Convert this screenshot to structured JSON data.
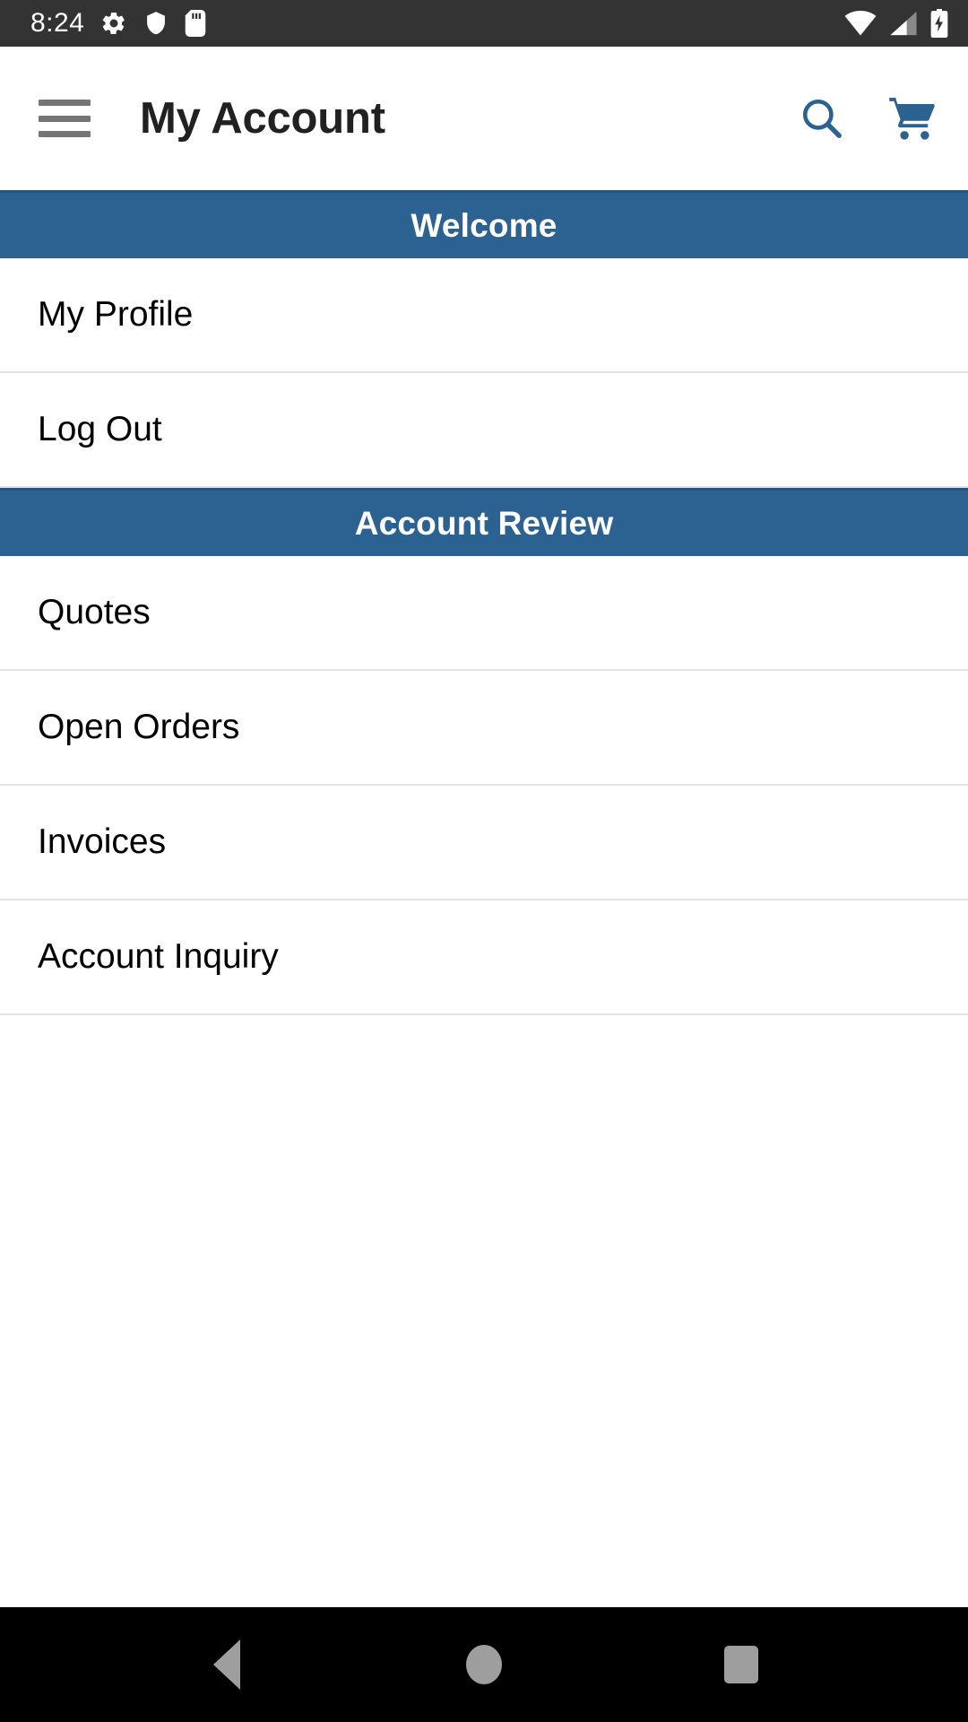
{
  "status_bar": {
    "clock": "8:24",
    "left_icons": [
      {
        "name": "settings-gear-icon",
        "label": "Settings"
      },
      {
        "name": "shield-icon",
        "label": "Security"
      },
      {
        "name": "sd-card-icon",
        "label": "SD Card"
      }
    ],
    "right_icons": [
      {
        "name": "wifi-icon",
        "label": "Wi-Fi"
      },
      {
        "name": "cell-signal-icon",
        "label": "Mobile Signal"
      },
      {
        "name": "battery-charging-icon",
        "label": "Battery Charging"
      }
    ],
    "background_color": "#333333",
    "icon_color": "#ffffff"
  },
  "app_bar": {
    "menu_label": "Menu",
    "menu_icon": "hamburger-menu-icon",
    "title": "My Account",
    "search_label": "Search",
    "search_icon": "search-icon",
    "cart_label": "Shopping Cart",
    "cart_icon": "shopping-cart-icon",
    "title_color": "#212121",
    "action_icon_color": "#2b6291",
    "menu_icon_color": "#757575"
  },
  "sections": [
    {
      "header": "Welcome",
      "items": [
        {
          "label": "My Profile"
        },
        {
          "label": "Log Out"
        }
      ]
    },
    {
      "header": "Account Review",
      "items": [
        {
          "label": "Quotes"
        },
        {
          "label": "Open Orders"
        },
        {
          "label": "Invoices"
        },
        {
          "label": "Account Inquiry"
        }
      ]
    }
  ],
  "theme": {
    "section_header_background": "#2b6291",
    "section_header_text": "#ffffff",
    "list_item_text": "#000000",
    "divider_color": "#e4e4e4",
    "page_background": "#ffffff"
  },
  "nav_bar": {
    "background_color": "#000000",
    "icon_color": "#9e9e9e",
    "buttons": [
      {
        "name": "back-button",
        "label": "Back",
        "icon": "triangle-left-icon"
      },
      {
        "name": "home-button",
        "label": "Home",
        "icon": "circle-icon"
      },
      {
        "name": "recents-button",
        "label": "Recents",
        "icon": "square-icon"
      }
    ]
  }
}
